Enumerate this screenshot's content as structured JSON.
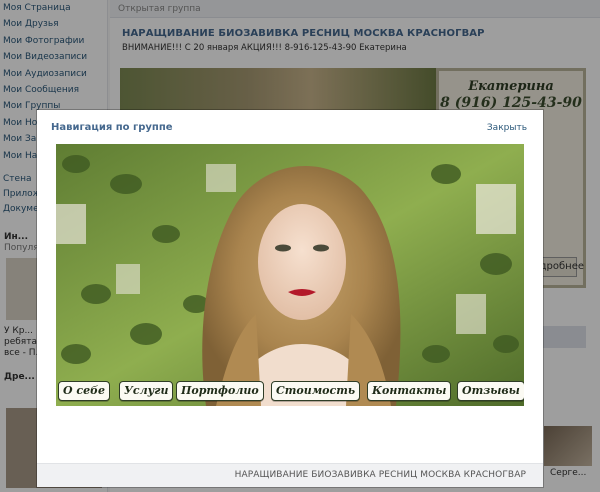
{
  "background": {
    "sidebar_items": [
      "Моя Страница",
      "Мои Друзья",
      "Мои Фотографии",
      "Мои Видеозаписи",
      "Мои Аудиозаписи",
      "Мои Сообщения",
      "Мои Группы",
      "Мои Новости",
      "Мои Закладки",
      "Мои Настройки"
    ],
    "sidebar_links": [
      "Стена",
      "Приложения",
      "Документы"
    ],
    "sidebar_snippets": [
      "Ин...",
      "Популярное",
      "У Кр...",
      "ребята... еще",
      "все - П...",
      "Дре..."
    ],
    "crumb": "Открытая группа",
    "group_title": "НАРАЩИВАНИЕ БИОЗАВИВКА РЕСНИЦ МОСКВА КРАСНОГВАР",
    "group_status": "ВНИМАНИЕ!!! С 20 января АКЦИЯ!!! 8-916-125-43-90 Екатерина",
    "card_name": "Екатерина",
    "card_phone": "8 (916) 125-43-90",
    "card_button": "Подробнее",
    "bottom_text": "Серге..."
  },
  "modal": {
    "title": "Навигация по группе",
    "close_label": "Закрыть",
    "menu": [
      "О себе",
      "Услуги",
      "Портфолио",
      "Стоимость",
      "Контакты",
      "Отзывы"
    ],
    "footer": "НАРАЩИВАНИЕ БИОЗАВИВКА РЕСНИЦ МОСКВА КРАСНОГВАР"
  },
  "colors": {
    "link": "#45688e",
    "overlay": "#000000",
    "menu_border": "#2f3d26"
  }
}
